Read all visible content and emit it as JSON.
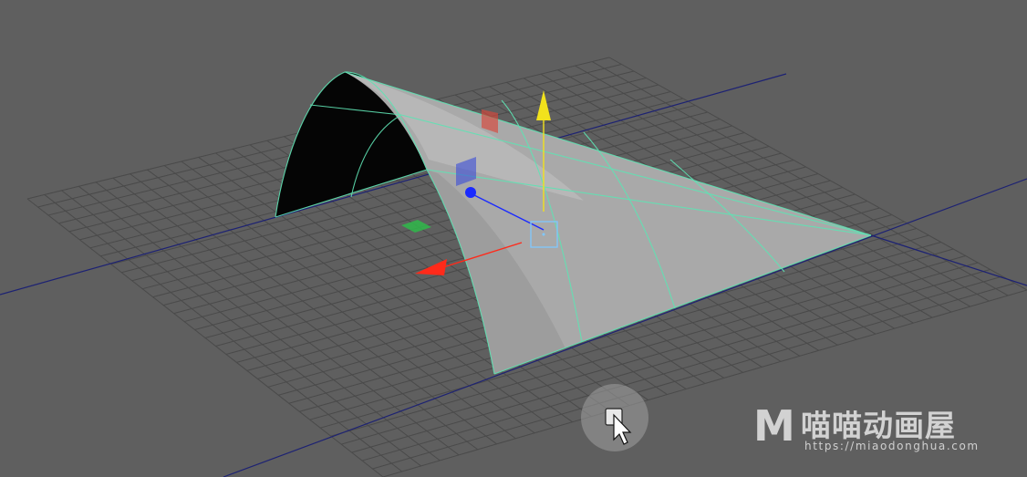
{
  "viewport": {
    "name": "Maya perspective viewport",
    "background_color": "#5f5f5f",
    "grid_color": "#4a4a4a",
    "axis_color": "#1a1f6e"
  },
  "object": {
    "surface_color": "#a8a8a8",
    "wire_color": "#5fe3b4",
    "inside_color": "#050505"
  },
  "manipulator": {
    "x_axis_color": "#ff2a1a",
    "y_axis_color": "#f2e21c",
    "z_axis_color": "#1a2aff",
    "center_color": "#7fc8ff",
    "xz_plane_color": "#2fb84a",
    "yz_plane_color": "#d9463a",
    "xy_plane_color": "#3a4cd9"
  },
  "cursor": {
    "icon": "mouse-pointer-icon",
    "highlight_color": "#8e8e8e"
  },
  "watermark": {
    "logo": "M",
    "name": "喵喵动画屋",
    "url": "https://miaodonghua.com"
  }
}
